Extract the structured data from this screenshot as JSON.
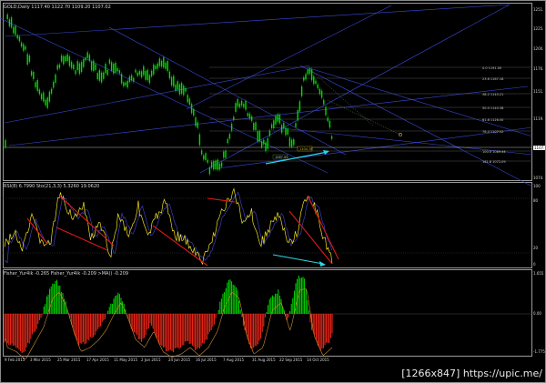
{
  "price_panel": {
    "header": "GOLD,Daily  1117.40 1122.70 1109.20 1107.02",
    "fib_labels": [
      "0.0 1191.00",
      "23.6 1167.18",
      "38.2 1145.21",
      "50.0 1140.38",
      "61.8 1126.50",
      "76.4 1107.12",
      "100.0 1089.44",
      "161.8 1072.09"
    ],
    "annotations": [
      "1104.78",
      "1087.00"
    ],
    "y_ticks": [
      "1251.",
      "1225.",
      "1200.",
      "1176.",
      "1151.",
      "1119.",
      "1101.",
      "1074."
    ],
    "price_badge": "1107."
  },
  "rsi_panel": {
    "header": "RSI(8) 6.7990  Sto(21,3,3) 5.3260 19.0620",
    "y_ticks": [
      "100",
      "80",
      "20",
      "0"
    ]
  },
  "fisher_panel": {
    "header": "Fisher_Yur4ik -0.265  Fisher_Yur4ik -0.209  >MA() -0.209",
    "y_ticks": [
      "1.655",
      "0.00",
      "-1.775"
    ]
  },
  "date_axis": [
    "9 Feb 2015",
    "3 Mar 2015",
    "25 Mar 2015",
    "17 Apr 2015",
    "11 May 2015",
    "2 Jun 2015",
    "24 Jun 2015",
    "16 Jul 2015",
    "7 Aug 2015",
    "31 Aug 2015",
    "22 Sep 2015",
    "14 Oct 2015"
  ],
  "watermark": "[1266x847] https://upic.me/",
  "colors": {
    "bull": "#00dd00",
    "bear": "#ff2a1a",
    "trend": "#3a4ad8",
    "rsi": "#f0e020",
    "stoch": "#3d3dc0",
    "arrow_red": "#e01818",
    "arrow_cyan": "#28d8e8"
  }
}
